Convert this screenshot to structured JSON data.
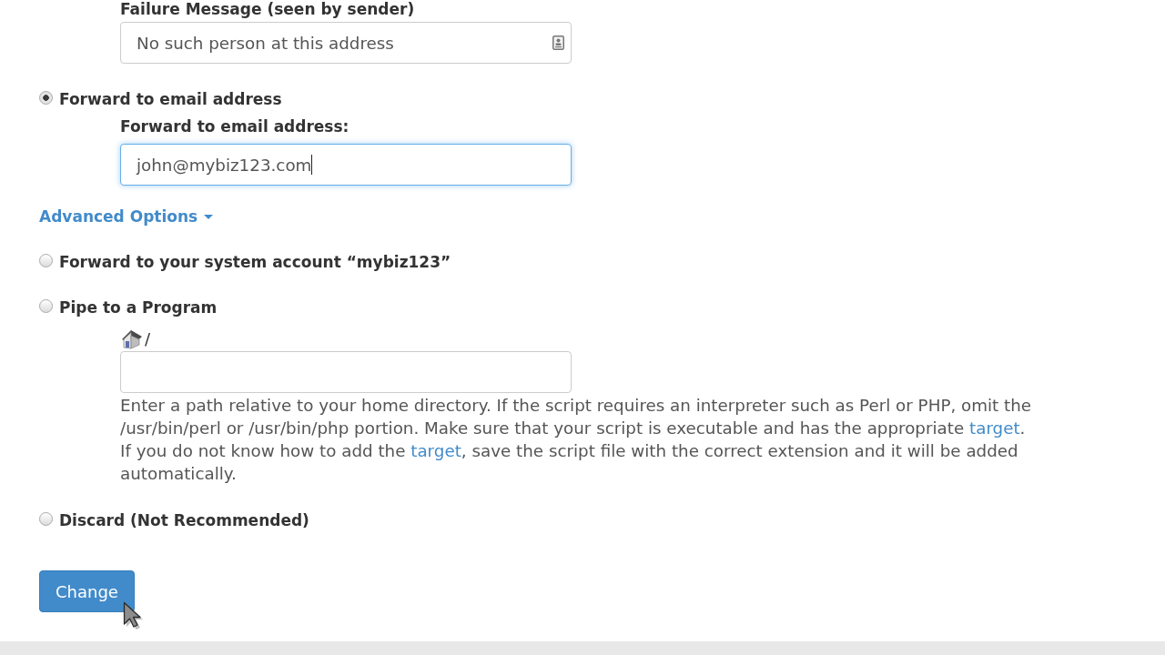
{
  "failure_message": {
    "label": "Failure Message (seen by sender)",
    "value": "No such person at this address",
    "focused": false
  },
  "options": [
    {
      "kind": "radio",
      "label": "Forward to email address",
      "selected": true,
      "field": {
        "label": "Forward to email address:",
        "value": "john@mybiz123.com",
        "focused": true
      }
    },
    {
      "kind": "link",
      "label": "Advanced Options"
    },
    {
      "kind": "radio",
      "label": "Forward to your system account “mybiz123”",
      "selected": false
    },
    {
      "kind": "radio",
      "label": "Pipe to a Program",
      "selected": false,
      "path_field": {
        "prefix": "/"
      },
      "help": [
        {
          "kind": "text",
          "text": "Enter a path relative to your home directory. If the script requires an interpreter such as Perl or PHP, omit the /usr/bin/perl or /usr/bin/php portion. Make sure that your script is executable and has the appropriate "
        },
        {
          "kind": "link",
          "text": "target"
        },
        {
          "kind": "text",
          "text": ". If you do not know how to add the "
        },
        {
          "kind": "link",
          "text": "target"
        },
        {
          "kind": "text",
          "text": ", save the script file with the correct extension and it will be added automatically."
        }
      ]
    },
    {
      "kind": "radio",
      "label": "Discard (Not Recommended)",
      "selected": false
    }
  ],
  "submit_button": {
    "label": "Change"
  }
}
